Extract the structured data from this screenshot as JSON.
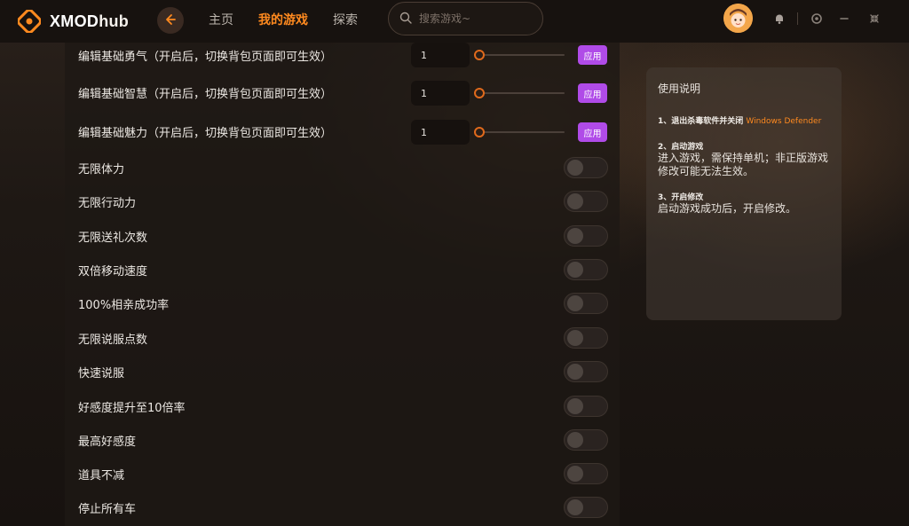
{
  "app": {
    "logo_text": "XMOD",
    "logo_text_hub": "hub"
  },
  "nav": {
    "items": [
      {
        "label": "主页",
        "active": false
      },
      {
        "label": "我的游戏",
        "active": true
      },
      {
        "label": "探索",
        "active": false
      }
    ]
  },
  "search": {
    "placeholder": "搜索游戏~",
    "value": ""
  },
  "slider_options": [
    {
      "label": "编辑基础勇气（开启后，切换背包页面即可生效）",
      "value": "1",
      "apply_label": "应用"
    },
    {
      "label": "编辑基础智慧（开启后，切换背包页面即可生效）",
      "value": "1",
      "apply_label": "应用"
    },
    {
      "label": "编辑基础魅力（开启后，切换背包页面即可生效）",
      "value": "1",
      "apply_label": "应用"
    }
  ],
  "toggle_options": [
    {
      "label": "无限体力",
      "on": false
    },
    {
      "label": "无限行动力",
      "on": false
    },
    {
      "label": "无限送礼次数",
      "on": false
    },
    {
      "label": "双倍移动速度",
      "on": false
    },
    {
      "label": "100%相亲成功率",
      "on": false
    },
    {
      "label": "无限说服点数",
      "on": false
    },
    {
      "label": "快速说服",
      "on": false
    },
    {
      "label": "好感度提升至10倍率",
      "on": false
    },
    {
      "label": "最高好感度",
      "on": false
    },
    {
      "label": "道具不减",
      "on": false
    },
    {
      "label": "停止所有车",
      "on": false
    }
  ],
  "instructions": {
    "title": "使用说明",
    "steps": [
      {
        "title": "1、退出杀毒软件并关闭 ",
        "highlight": "Windows Defender",
        "body": ""
      },
      {
        "title": "2、启动游戏",
        "highlight": "",
        "body": "进入游戏，需保持单机；非正版游戏修改可能无法生效。"
      },
      {
        "title": "3、开启修改",
        "highlight": "",
        "body": "启动游戏成功后，开启修改。"
      }
    ]
  },
  "colors": {
    "accent": "#ff8a1f",
    "apply_button": "#b04be8",
    "background": "#1a1411"
  },
  "icons": [
    "logo-icon",
    "back-arrow-icon",
    "search-icon",
    "bell-icon",
    "settings-icon",
    "minimize-icon",
    "collapse-icon"
  ]
}
